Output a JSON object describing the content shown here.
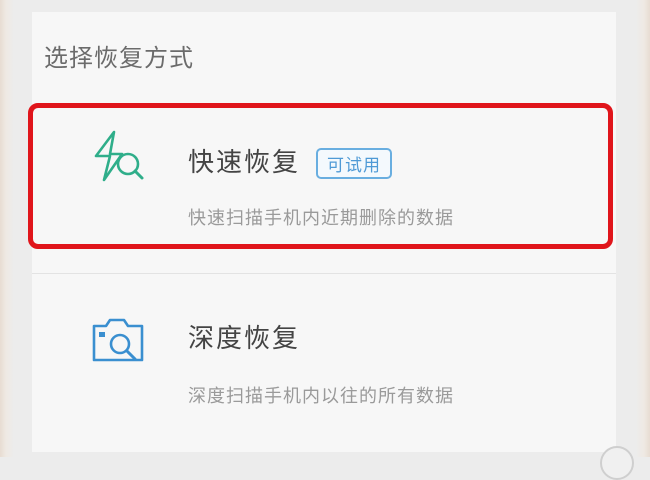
{
  "section": {
    "title": "选择恢复方式"
  },
  "options": [
    {
      "title": "快速恢复",
      "badge": "可试用",
      "description": "快速扫描手机内近期删除的数据",
      "icon": "lightning-search-icon"
    },
    {
      "title": "深度恢复",
      "description": "深度扫描手机内以往的所有数据",
      "icon": "camera-search-icon"
    }
  ],
  "colors": {
    "highlight": "#e0151b",
    "quick_icon": "#2fae8a",
    "deep_icon": "#3a8fd0",
    "badge": "#4f9ad6"
  }
}
